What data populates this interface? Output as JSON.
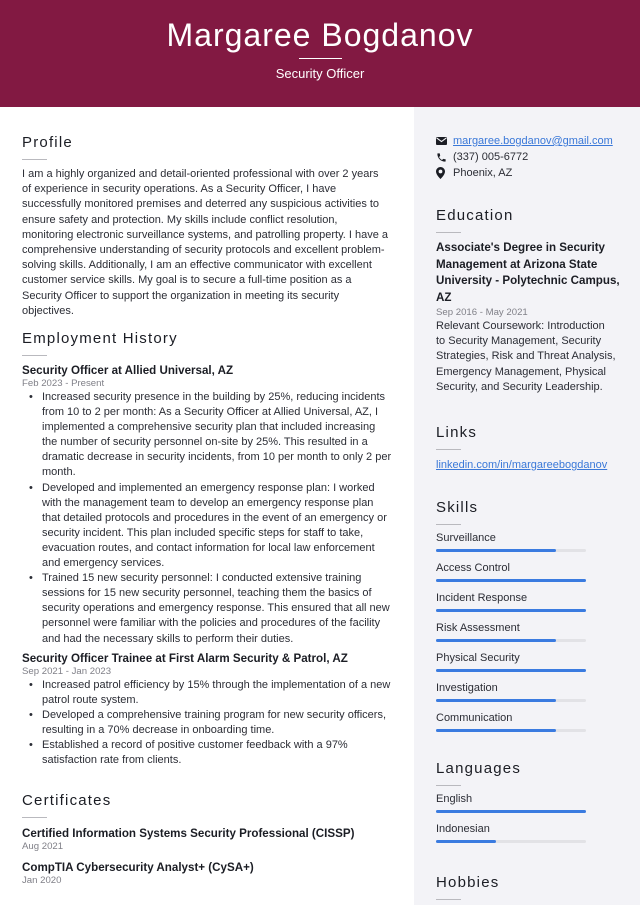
{
  "header": {
    "name": "Margaree Bogdanov",
    "title": "Security Officer",
    "bg_color": "#821942"
  },
  "profile": {
    "heading": "Profile",
    "text": "I am a highly organized and detail-oriented professional with over 2 years of experience in security operations. As a Security Officer, I have successfully monitored premises and deterred any suspicious activities to ensure safety and protection. My skills include conflict resolution, monitoring electronic surveillance systems, and patrolling property. I have a comprehensive understanding of security protocols and excellent problem-solving skills. Additionally, I am an effective communicator with excellent customer service skills. My goal is to secure a full-time position as a Security Officer to support the organization in meeting its security objectives."
  },
  "employment": {
    "heading": "Employment History",
    "jobs": [
      {
        "title": "Security Officer at Allied Universal, AZ",
        "dates": "Feb 2023 - Present",
        "bullets": [
          "Increased security presence in the building by 25%, reducing incidents from 10 to 2 per month: As a Security Officer at Allied Universal, AZ, I implemented a comprehensive security plan that included increasing the number of security personnel on-site by 25%. This resulted in a dramatic decrease in security incidents, from 10 per month to only 2 per month.",
          "Developed and implemented an emergency response plan: I worked with the management team to develop an emergency response plan that detailed protocols and procedures in the event of an emergency or security incident. This plan included specific steps for staff to take, evacuation routes, and contact information for local law enforcement and emergency services.",
          "Trained 15 new security personnel: I conducted extensive training sessions for 15 new security personnel, teaching them the basics of security operations and emergency response. This ensured that all new personnel were familiar with the policies and procedures of the facility and had the necessary skills to perform their duties."
        ]
      },
      {
        "title": "Security Officer Trainee at First Alarm Security & Patrol, AZ",
        "dates": "Sep 2021 - Jan 2023",
        "bullets": [
          "Increased patrol efficiency by 15% through the implementation of a new patrol route system.",
          "Developed a comprehensive training program for new security officers, resulting in a 70% decrease in onboarding time.",
          "Established a record of positive customer feedback with a 97% satisfaction rate from clients."
        ]
      }
    ]
  },
  "certificates": {
    "heading": "Certificates",
    "items": [
      {
        "name": "Certified Information Systems Security Professional (CISSP)",
        "date": "Aug 2021"
      },
      {
        "name": "CompTIA Cybersecurity Analyst+ (CySA+)",
        "date": "Jan 2020"
      }
    ]
  },
  "contact": {
    "email": "margaree.bogdanov@gmail.com",
    "phone": "(337) 005-6772",
    "location": "Phoenix, AZ",
    "icons": {
      "email": "envelope-icon",
      "phone": "phone-icon",
      "location": "map-pin-icon"
    }
  },
  "education": {
    "heading": "Education",
    "degree": "Associate's Degree in Security Management at Arizona State University - Polytechnic Campus, AZ",
    "dates": "Sep 2016 - May 2021",
    "description": "Relevant Coursework: Introduction to Security Management, Security Strategies, Risk and Threat Analysis, Emergency Management, Physical Security, and Security Leadership."
  },
  "links": {
    "heading": "Links",
    "items": [
      "linkedin.com/in/margareebogdanov"
    ]
  },
  "skills": {
    "heading": "Skills",
    "accent": "#3a7be0",
    "items": [
      {
        "label": "Surveillance",
        "level": 80
      },
      {
        "label": "Access Control",
        "level": 100
      },
      {
        "label": "Incident Response",
        "level": 100
      },
      {
        "label": "Risk Assessment",
        "level": 80
      },
      {
        "label": "Physical Security",
        "level": 100
      },
      {
        "label": "Investigation",
        "level": 80
      },
      {
        "label": "Communication",
        "level": 80
      }
    ]
  },
  "languages": {
    "heading": "Languages",
    "items": [
      {
        "label": "English",
        "level": 100
      },
      {
        "label": "Indonesian",
        "level": 40
      }
    ]
  },
  "hobbies": {
    "heading": "Hobbies"
  }
}
